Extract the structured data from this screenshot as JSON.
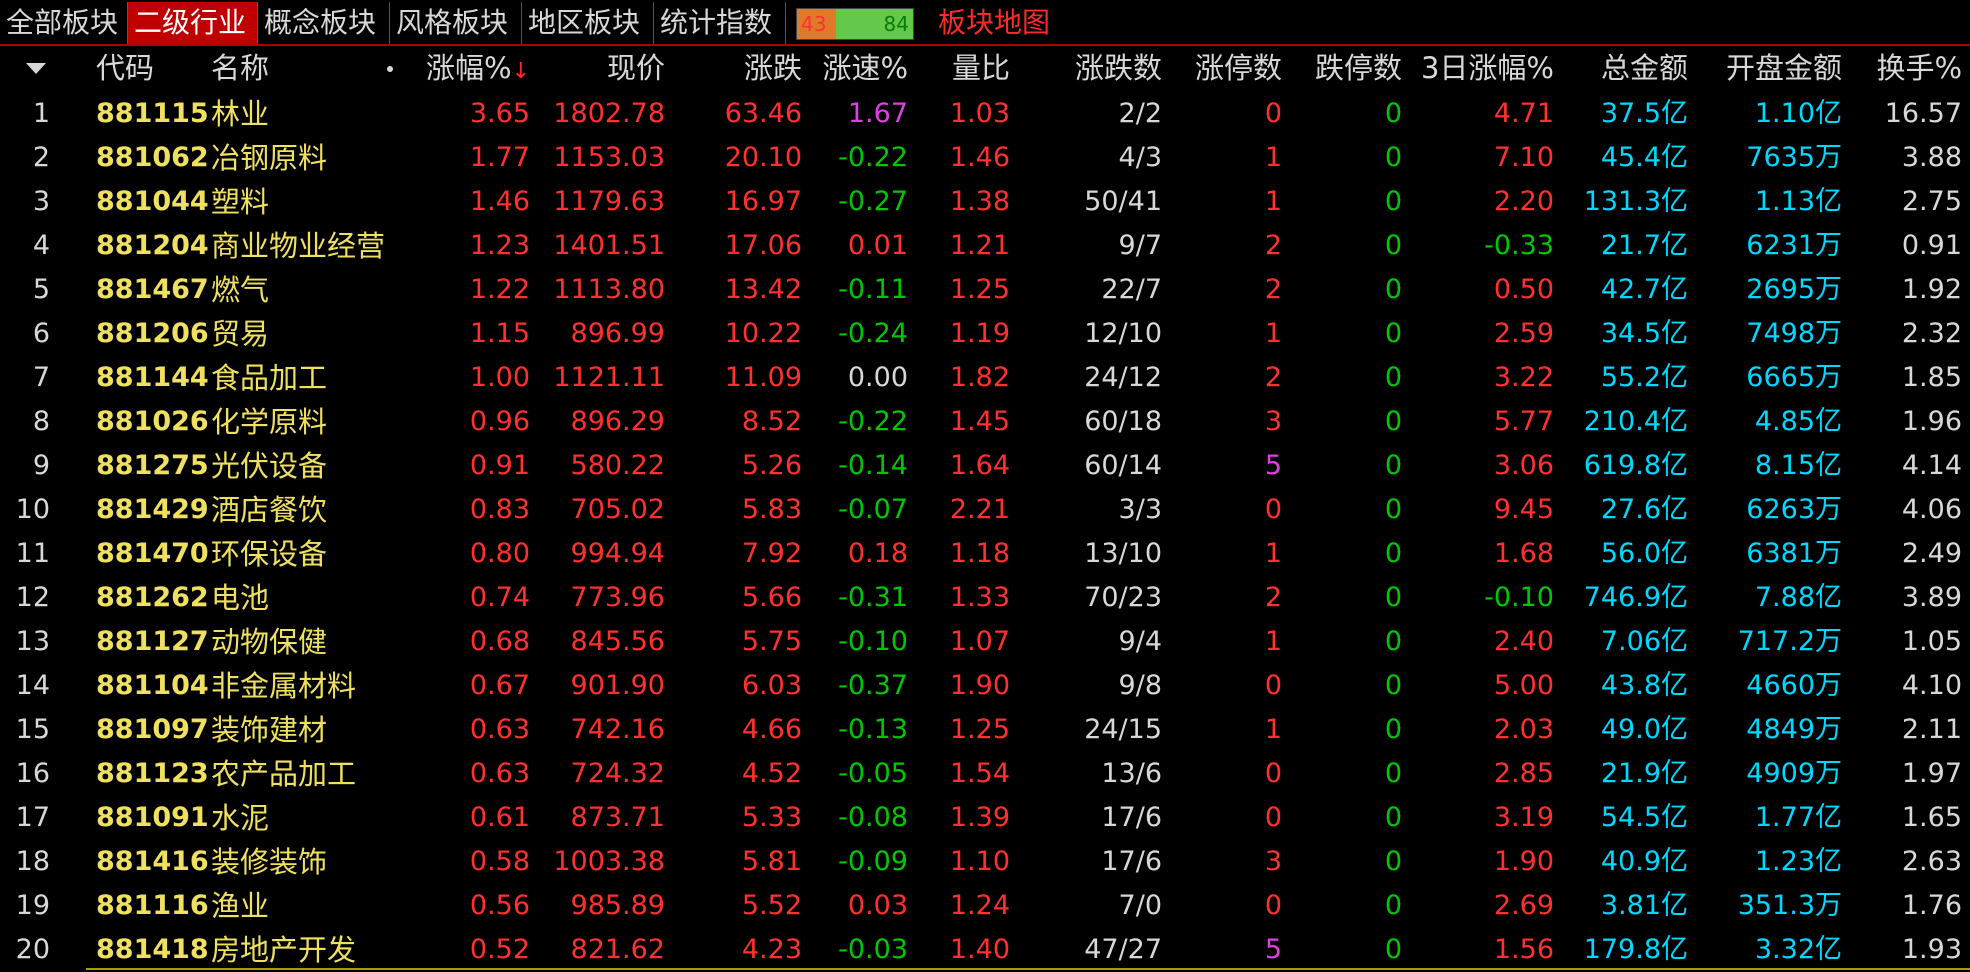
{
  "tabs": [
    {
      "label": "全部板块",
      "active": false
    },
    {
      "label": "二级行业",
      "active": true
    },
    {
      "label": "概念板块",
      "active": false
    },
    {
      "label": "风格板块",
      "active": false
    },
    {
      "label": "地区板块",
      "active": false
    },
    {
      "label": "统计指数",
      "active": false
    }
  ],
  "updown_ratio": {
    "up": "43",
    "down": "84",
    "up_fraction": 0.34
  },
  "map_link": "板块地图",
  "headers": {
    "code": "代码",
    "name": "名称",
    "pct": "涨幅%",
    "sort_arrow": "↓",
    "price": "现价",
    "change": "涨跌",
    "speed": "涨速%",
    "vol_ratio": "量比",
    "adv_dec": "涨跌数",
    "limit_up": "涨停数",
    "limit_down": "跌停数",
    "ret3d": "3日涨幅%",
    "amount": "总金额",
    "open_amount": "开盘金额",
    "turnover": "换手%"
  },
  "colors": {
    "rise": "#ff3030",
    "fall": "#00c800",
    "flat": "#d8d8d8",
    "accent": "#c00000",
    "code": "#f0e060",
    "amount": "#00d8ff"
  },
  "rows": [
    {
      "idx": "1",
      "code": "881115",
      "name": "林业",
      "pct": "3.65",
      "price": "1802.78",
      "change": "63.46",
      "speed": "1.67",
      "vr": "1.03",
      "ad": "2/2",
      "lu": "0",
      "ld": "0",
      "r3": "4.71",
      "amt": "37.5亿",
      "open": "1.10亿",
      "turn": "16.57"
    },
    {
      "idx": "2",
      "code": "881062",
      "name": "冶钢原料",
      "pct": "1.77",
      "price": "1153.03",
      "change": "20.10",
      "speed": "-0.22",
      "vr": "1.46",
      "ad": "4/3",
      "lu": "1",
      "ld": "0",
      "r3": "7.10",
      "amt": "45.4亿",
      "open": "7635万",
      "turn": "3.88"
    },
    {
      "idx": "3",
      "code": "881044",
      "name": "塑料",
      "pct": "1.46",
      "price": "1179.63",
      "change": "16.97",
      "speed": "-0.27",
      "vr": "1.38",
      "ad": "50/41",
      "lu": "1",
      "ld": "0",
      "r3": "2.20",
      "amt": "131.3亿",
      "open": "1.13亿",
      "turn": "2.75"
    },
    {
      "idx": "4",
      "code": "881204",
      "name": "商业物业经营",
      "pct": "1.23",
      "price": "1401.51",
      "change": "17.06",
      "speed": "0.01",
      "vr": "1.21",
      "ad": "9/7",
      "lu": "2",
      "ld": "0",
      "r3": "-0.33",
      "amt": "21.7亿",
      "open": "6231万",
      "turn": "0.91"
    },
    {
      "idx": "5",
      "code": "881467",
      "name": "燃气",
      "pct": "1.22",
      "price": "1113.80",
      "change": "13.42",
      "speed": "-0.11",
      "vr": "1.25",
      "ad": "22/7",
      "lu": "2",
      "ld": "0",
      "r3": "0.50",
      "amt": "42.7亿",
      "open": "2695万",
      "turn": "1.92"
    },
    {
      "idx": "6",
      "code": "881206",
      "name": "贸易",
      "pct": "1.15",
      "price": "896.99",
      "change": "10.22",
      "speed": "-0.24",
      "vr": "1.19",
      "ad": "12/10",
      "lu": "1",
      "ld": "0",
      "r3": "2.59",
      "amt": "34.5亿",
      "open": "7498万",
      "turn": "2.32"
    },
    {
      "idx": "7",
      "code": "881144",
      "name": "食品加工",
      "pct": "1.00",
      "price": "1121.11",
      "change": "11.09",
      "speed": "0.00",
      "vr": "1.82",
      "ad": "24/12",
      "lu": "2",
      "ld": "0",
      "r3": "3.22",
      "amt": "55.2亿",
      "open": "6665万",
      "turn": "1.85"
    },
    {
      "idx": "8",
      "code": "881026",
      "name": "化学原料",
      "pct": "0.96",
      "price": "896.29",
      "change": "8.52",
      "speed": "-0.22",
      "vr": "1.45",
      "ad": "60/18",
      "lu": "3",
      "ld": "0",
      "r3": "5.77",
      "amt": "210.4亿",
      "open": "4.85亿",
      "turn": "1.96"
    },
    {
      "idx": "9",
      "code": "881275",
      "name": "光伏设备",
      "pct": "0.91",
      "price": "580.22",
      "change": "5.26",
      "speed": "-0.14",
      "vr": "1.64",
      "ad": "60/14",
      "lu": "5",
      "ld": "0",
      "r3": "3.06",
      "amt": "619.8亿",
      "open": "8.15亿",
      "turn": "4.14"
    },
    {
      "idx": "10",
      "code": "881429",
      "name": "酒店餐饮",
      "pct": "0.83",
      "price": "705.02",
      "change": "5.83",
      "speed": "-0.07",
      "vr": "2.21",
      "ad": "3/3",
      "lu": "0",
      "ld": "0",
      "r3": "9.45",
      "amt": "27.6亿",
      "open": "6263万",
      "turn": "4.06"
    },
    {
      "idx": "11",
      "code": "881470",
      "name": "环保设备",
      "pct": "0.80",
      "price": "994.94",
      "change": "7.92",
      "speed": "0.18",
      "vr": "1.18",
      "ad": "13/10",
      "lu": "1",
      "ld": "0",
      "r3": "1.68",
      "amt": "56.0亿",
      "open": "6381万",
      "turn": "2.49"
    },
    {
      "idx": "12",
      "code": "881262",
      "name": "电池",
      "pct": "0.74",
      "price": "773.96",
      "change": "5.66",
      "speed": "-0.31",
      "vr": "1.33",
      "ad": "70/23",
      "lu": "2",
      "ld": "0",
      "r3": "-0.10",
      "amt": "746.9亿",
      "open": "7.88亿",
      "turn": "3.89"
    },
    {
      "idx": "13",
      "code": "881127",
      "name": "动物保健",
      "pct": "0.68",
      "price": "845.56",
      "change": "5.75",
      "speed": "-0.10",
      "vr": "1.07",
      "ad": "9/4",
      "lu": "1",
      "ld": "0",
      "r3": "2.40",
      "amt": "7.06亿",
      "open": "717.2万",
      "turn": "1.05"
    },
    {
      "idx": "14",
      "code": "881104",
      "name": "非金属材料",
      "pct": "0.67",
      "price": "901.90",
      "change": "6.03",
      "speed": "-0.37",
      "vr": "1.90",
      "ad": "9/8",
      "lu": "0",
      "ld": "0",
      "r3": "5.00",
      "amt": "43.8亿",
      "open": "4660万",
      "turn": "4.10"
    },
    {
      "idx": "15",
      "code": "881097",
      "name": "装饰建材",
      "pct": "0.63",
      "price": "742.16",
      "change": "4.66",
      "speed": "-0.13",
      "vr": "1.25",
      "ad": "24/15",
      "lu": "1",
      "ld": "0",
      "r3": "2.03",
      "amt": "49.0亿",
      "open": "4849万",
      "turn": "2.11"
    },
    {
      "idx": "16",
      "code": "881123",
      "name": "农产品加工",
      "pct": "0.63",
      "price": "724.32",
      "change": "4.52",
      "speed": "-0.05",
      "vr": "1.54",
      "ad": "13/6",
      "lu": "0",
      "ld": "0",
      "r3": "2.85",
      "amt": "21.9亿",
      "open": "4909万",
      "turn": "1.97"
    },
    {
      "idx": "17",
      "code": "881091",
      "name": "水泥",
      "pct": "0.61",
      "price": "873.71",
      "change": "5.33",
      "speed": "-0.08",
      "vr": "1.39",
      "ad": "17/6",
      "lu": "0",
      "ld": "0",
      "r3": "3.19",
      "amt": "54.5亿",
      "open": "1.77亿",
      "turn": "1.65"
    },
    {
      "idx": "18",
      "code": "881416",
      "name": "装修装饰",
      "pct": "0.58",
      "price": "1003.38",
      "change": "5.81",
      "speed": "-0.09",
      "vr": "1.10",
      "ad": "17/6",
      "lu": "3",
      "ld": "0",
      "r3": "1.90",
      "amt": "40.9亿",
      "open": "1.23亿",
      "turn": "2.63"
    },
    {
      "idx": "19",
      "code": "881116",
      "name": "渔业",
      "pct": "0.56",
      "price": "985.89",
      "change": "5.52",
      "speed": "0.03",
      "vr": "1.24",
      "ad": "7/0",
      "lu": "0",
      "ld": "0",
      "r3": "2.69",
      "amt": "3.81亿",
      "open": "351.3万",
      "turn": "1.76"
    },
    {
      "idx": "20",
      "code": "881418",
      "name": "房地产开发",
      "pct": "0.52",
      "price": "821.62",
      "change": "4.23",
      "speed": "-0.03",
      "vr": "1.40",
      "ad": "47/27",
      "lu": "5",
      "ld": "0",
      "r3": "1.56",
      "amt": "179.8亿",
      "open": "3.32亿",
      "turn": "1.93"
    }
  ]
}
